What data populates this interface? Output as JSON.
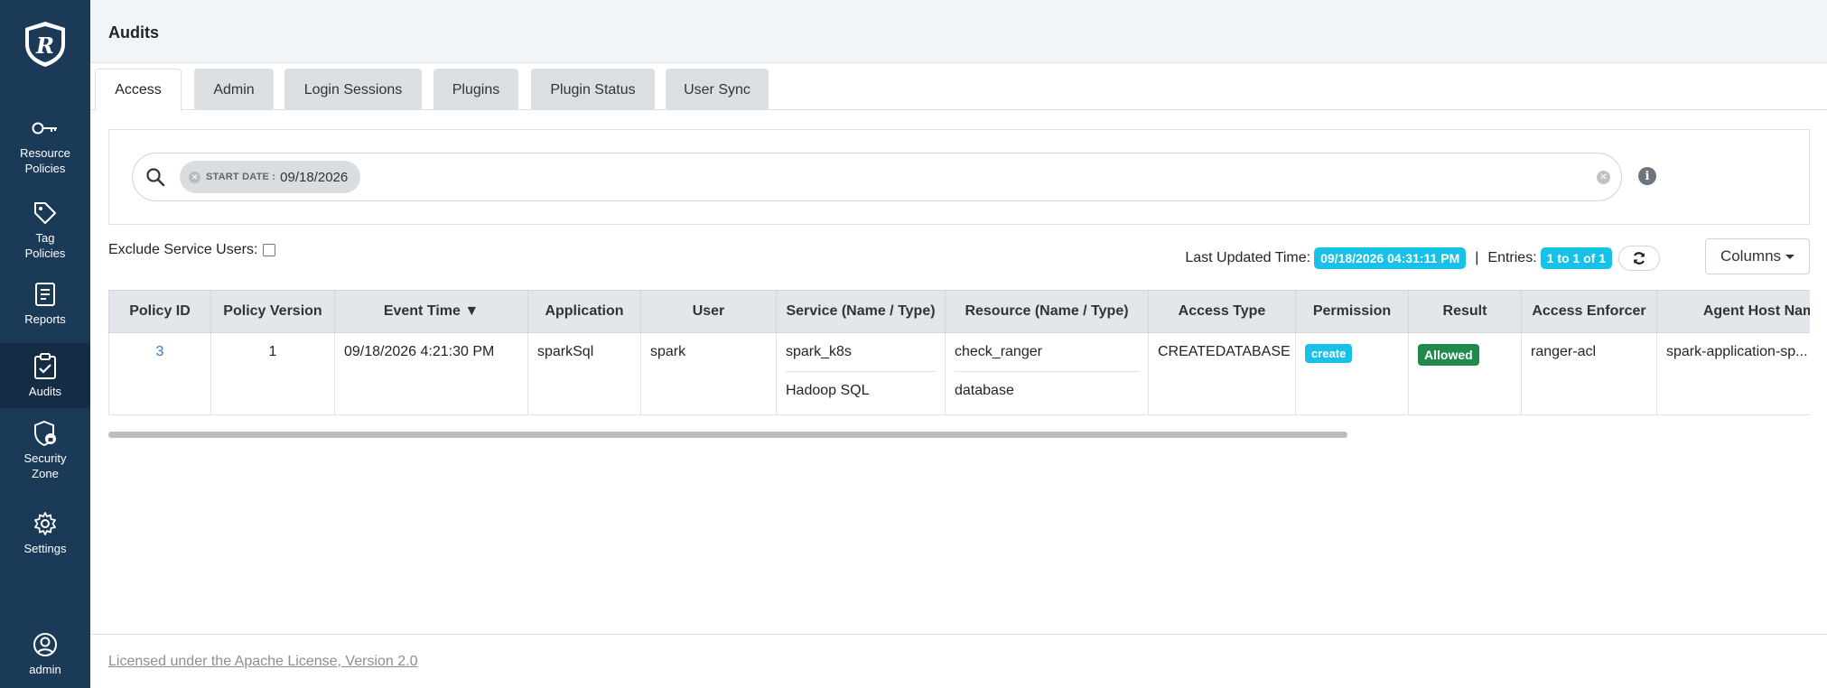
{
  "sidebar": {
    "items": [
      {
        "label": "Resource Policies",
        "icon": "key-icon"
      },
      {
        "label": "Tag Policies",
        "icon": "tag-icon"
      },
      {
        "label": "Reports",
        "icon": "report-icon"
      },
      {
        "label": "Audits",
        "icon": "clipboard-check-icon",
        "active": true
      },
      {
        "label": "Security Zone",
        "icon": "shield-lock-icon"
      },
      {
        "label": "Settings",
        "icon": "gear-icon"
      }
    ],
    "user": {
      "label": "admin",
      "icon": "user-circle-icon"
    }
  },
  "header": {
    "title": "Audits"
  },
  "tabs": [
    {
      "label": "Access",
      "active": true
    },
    {
      "label": "Admin"
    },
    {
      "label": "Login Sessions"
    },
    {
      "label": "Plugins"
    },
    {
      "label": "Plugin Status"
    },
    {
      "label": "User Sync"
    }
  ],
  "search": {
    "chip_key": "START DATE :",
    "chip_value": "09/18/2026"
  },
  "filters": {
    "exclude_label": "Exclude Service Users:",
    "last_updated_label": "Last Updated Time:",
    "last_updated_value": "09/18/2026 04:31:11 PM",
    "separator": "|",
    "entries_label": "Entries:",
    "entries_value": "1 to 1 of 1",
    "columns_label": "Columns"
  },
  "table": {
    "headers": [
      "Policy ID",
      "Policy Version",
      "Event Time ▼",
      "Application",
      "User",
      "Service (Name / Type)",
      "Resource (Name / Type)",
      "Access Type",
      "Permission",
      "Result",
      "Access Enforcer",
      "Agent Host Name"
    ],
    "rows": [
      {
        "policy_id": "3",
        "policy_version": "1",
        "event_time": "09/18/2026 4:21:30 PM",
        "application": "sparkSql",
        "user": "spark",
        "service_name": "spark_k8s",
        "service_type": "Hadoop SQL",
        "resource_name": "check_ranger",
        "resource_type": "database",
        "access_type": "CREATEDATABASE",
        "permission": "create",
        "result": "Allowed",
        "access_enforcer": "ranger-acl",
        "agent_host": "spark-application-sp..."
      }
    ]
  },
  "footer": {
    "license": "Licensed under the Apache License, Version 2.0"
  },
  "colors": {
    "sidebar": "#1b3a57",
    "accent": "#17c1e8",
    "success": "#208a4a"
  }
}
